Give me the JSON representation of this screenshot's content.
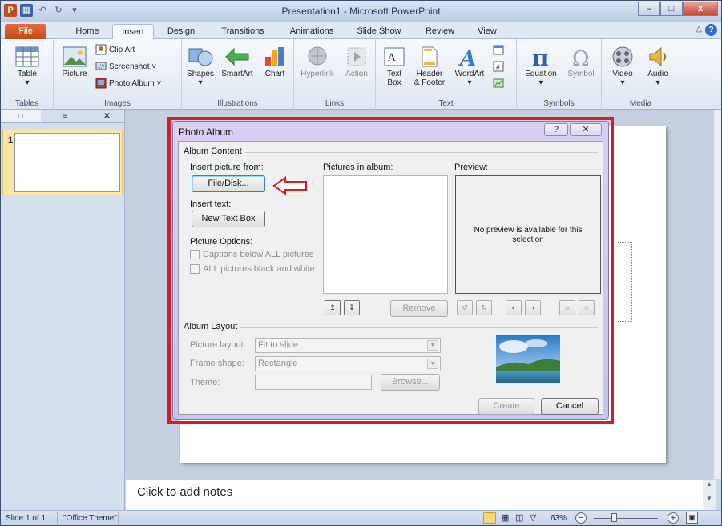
{
  "window": {
    "title": "Presentation1 - Microsoft PowerPoint",
    "minimize": "–",
    "maximize": "□",
    "close": "x"
  },
  "tabs": [
    {
      "label": "File"
    },
    {
      "label": "Home"
    },
    {
      "label": "Insert"
    },
    {
      "label": "Design"
    },
    {
      "label": "Transitions"
    },
    {
      "label": "Animations"
    },
    {
      "label": "Slide Show"
    },
    {
      "label": "Review"
    },
    {
      "label": "View"
    }
  ],
  "help": "?",
  "ribbon": {
    "tables": {
      "label": "Tables",
      "table": "Table"
    },
    "images": {
      "label": "Images",
      "picture": "Picture",
      "clip_art": "Clip Art",
      "screenshot": "Screenshot ˅",
      "photo_album": "Photo Album ˅"
    },
    "illustrations": {
      "label": "Illustrations",
      "shapes": "Shapes",
      "smartart": "SmartArt",
      "chart": "Chart"
    },
    "links": {
      "label": "Links",
      "hyperlink": "Hyperlink",
      "action": "Action"
    },
    "text": {
      "label": "Text",
      "text_box_1": "Text",
      "text_box_2": "Box",
      "header_1": "Header",
      "header_2": "& Footer",
      "wordart": "WordArt"
    },
    "symbols": {
      "label": "Symbols",
      "equation": "Equation",
      "symbol": "Symbol"
    },
    "media": {
      "label": "Media",
      "video": "Video",
      "audio": "Audio"
    }
  },
  "slide_pane": {
    "slide_number": "1"
  },
  "notes": {
    "placeholder": "Click to add notes"
  },
  "status": {
    "slide": "Slide 1 of 1",
    "theme": "\"Office Theme\"",
    "zoom": "63%"
  },
  "dialog": {
    "title": "Photo Album",
    "help": "?",
    "close": "✕",
    "album_content": "Album Content",
    "insert_picture_from": "Insert picture from:",
    "file_disk": "File/Disk...",
    "insert_text": "Insert text:",
    "new_text_box": "New Text Box",
    "picture_options": "Picture Options:",
    "captions_below": "Captions below ALL pictures",
    "all_black_white": "ALL pictures black and white",
    "pictures_in_album": "Pictures in album:",
    "preview": "Preview:",
    "no_preview": "No preview is available for this selection",
    "remove": "Remove",
    "album_layout": "Album Layout",
    "picture_layout_label": "Picture layout:",
    "picture_layout_value": "Fit to slide",
    "frame_shape_label": "Frame shape:",
    "frame_shape_value": "Rectangle",
    "theme_label": "Theme:",
    "browse": "Browse...",
    "create": "Create",
    "cancel": "Cancel"
  },
  "colors": {
    "highlight": "#d71c22",
    "arrow": "#d71c22",
    "file_tab": "#d3541f"
  }
}
